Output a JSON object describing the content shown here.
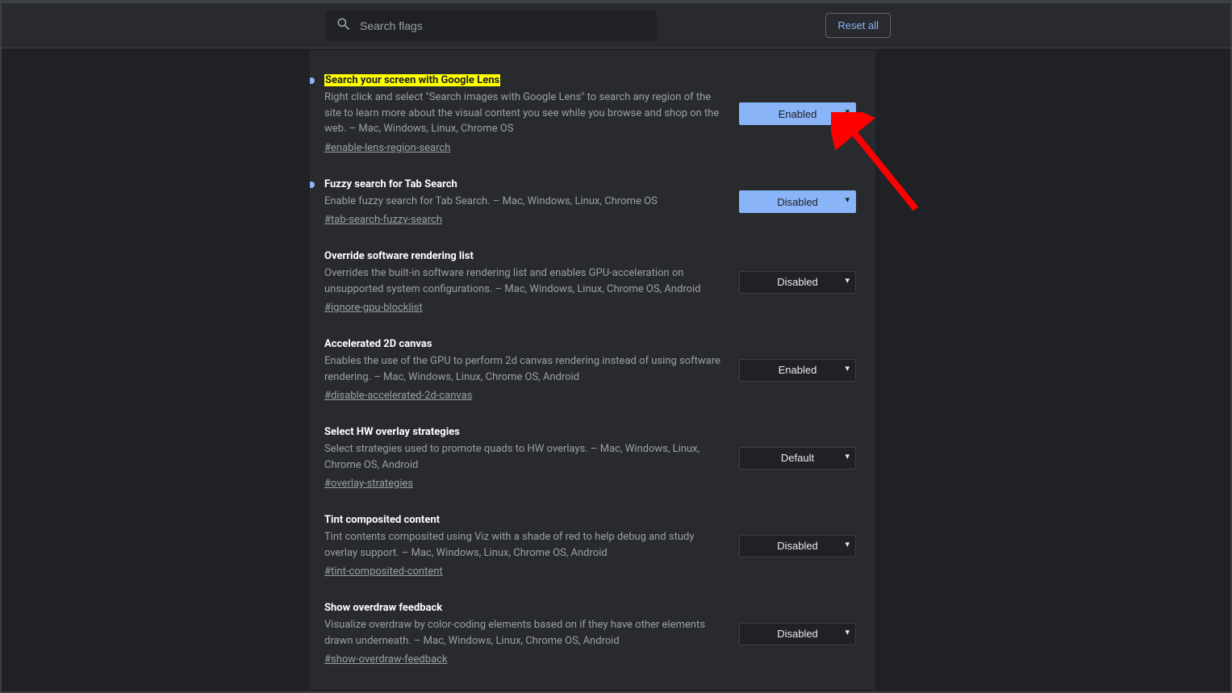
{
  "search": {
    "placeholder": "Search flags"
  },
  "reset_label": "Reset all",
  "flags": [
    {
      "title": "Search your screen with Google Lens",
      "desc": "Right click and select \"Search images with Google Lens\" to search any region of the site to learn more about the visual content you see while you browse and shop on the web. – Mac, Windows, Linux, Chrome OS",
      "hash": "#enable-lens-region-search",
      "value": "Enabled",
      "dot": true,
      "modified": true,
      "highlight": true
    },
    {
      "title": "Fuzzy search for Tab Search",
      "desc": "Enable fuzzy search for Tab Search. – Mac, Windows, Linux, Chrome OS",
      "hash": "#tab-search-fuzzy-search",
      "value": "Disabled",
      "dot": true,
      "modified": true,
      "highlight": false
    },
    {
      "title": "Override software rendering list",
      "desc": "Overrides the built-in software rendering list and enables GPU-acceleration on unsupported system configurations. – Mac, Windows, Linux, Chrome OS, Android",
      "hash": "#ignore-gpu-blocklist",
      "value": "Disabled",
      "dot": false,
      "modified": false,
      "highlight": false
    },
    {
      "title": "Accelerated 2D canvas",
      "desc": "Enables the use of the GPU to perform 2d canvas rendering instead of using software rendering. – Mac, Windows, Linux, Chrome OS, Android",
      "hash": "#disable-accelerated-2d-canvas",
      "value": "Enabled",
      "dot": false,
      "modified": false,
      "highlight": false
    },
    {
      "title": "Select HW overlay strategies",
      "desc": "Select strategies used to promote quads to HW overlays. – Mac, Windows, Linux, Chrome OS, Android",
      "hash": "#overlay-strategies",
      "value": "Default",
      "dot": false,
      "modified": false,
      "highlight": false
    },
    {
      "title": "Tint composited content",
      "desc": "Tint contents composited using Viz with a shade of red to help debug and study overlay support. – Mac, Windows, Linux, Chrome OS, Android",
      "hash": "#tint-composited-content",
      "value": "Disabled",
      "dot": false,
      "modified": false,
      "highlight": false
    },
    {
      "title": "Show overdraw feedback",
      "desc": "Visualize overdraw by color-coding elements based on if they have other elements drawn underneath. – Mac, Windows, Linux, Chrome OS, Android",
      "hash": "#show-overdraw-feedback",
      "value": "Disabled",
      "dot": false,
      "modified": false,
      "highlight": false
    }
  ],
  "select_options": [
    "Default",
    "Enabled",
    "Disabled"
  ],
  "annotation": {
    "arrow_color": "#ff0000"
  }
}
